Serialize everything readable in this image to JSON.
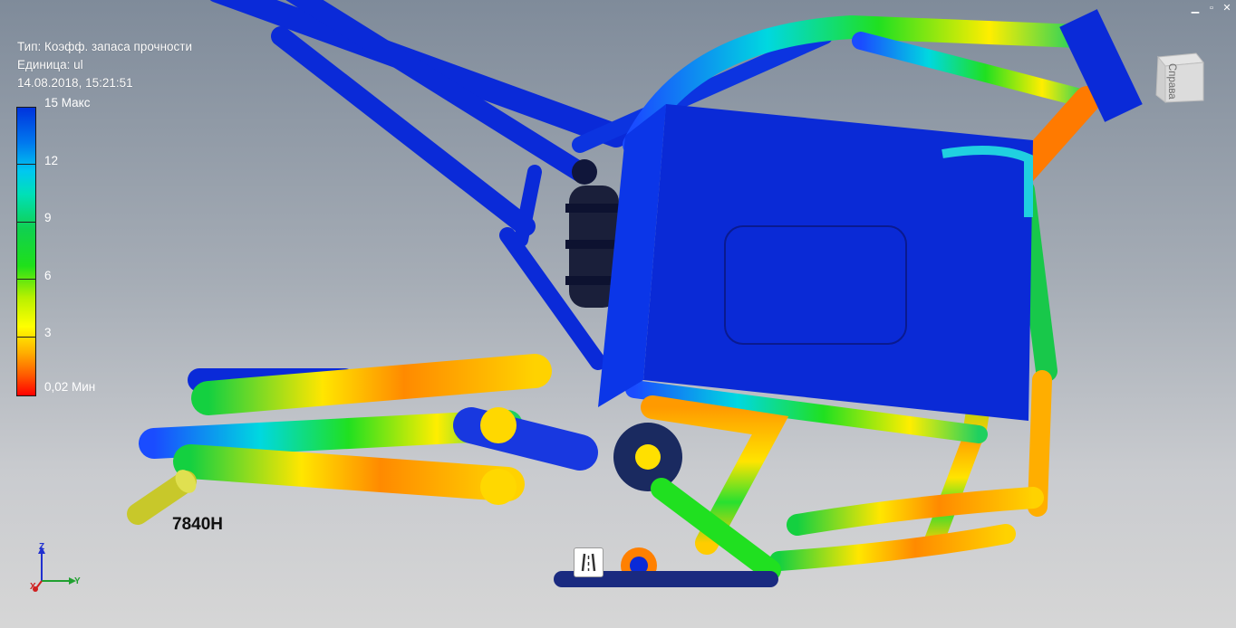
{
  "info": {
    "type_line": "Тип: Коэфф. запаса прочности",
    "unit_line": "Единица: ul",
    "timestamp": "14.08.2018, 15:21:51"
  },
  "legend": {
    "ticks": [
      {
        "label": "15 Макс"
      },
      {
        "label": "12"
      },
      {
        "label": "9"
      },
      {
        "label": "6"
      },
      {
        "label": "3"
      },
      {
        "label": "0,02 Мин"
      }
    ],
    "colors": [
      "#0033dd",
      "#00c8f0",
      "#10d050",
      "#1fe01a",
      "#ffff00",
      "#ff5a00",
      "#ff0000"
    ]
  },
  "load": {
    "label": "7840Н"
  },
  "viewcube": {
    "face_label": "Справа"
  },
  "triad": {
    "x": "X",
    "y": "Y",
    "z": "Z"
  },
  "window": {
    "minimize": "▁",
    "restore": "▫",
    "close": "✕"
  },
  "icons": {
    "viewcube": "view-cube-icon",
    "triad": "axis-triad-icon",
    "nav": "navigation-wheel-icon",
    "load": "force-arrow-icon"
  }
}
